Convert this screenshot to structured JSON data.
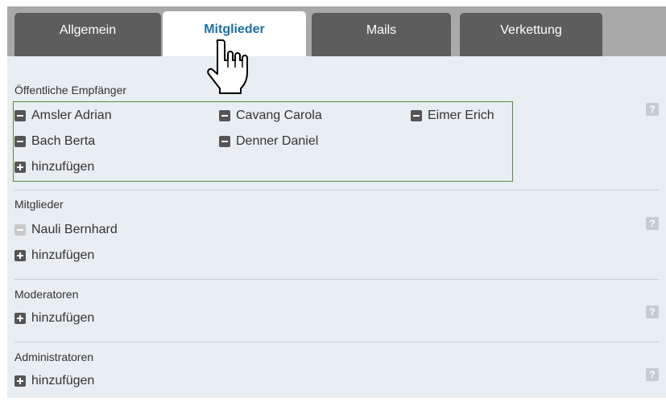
{
  "tabs": [
    {
      "label": "Allgemein"
    },
    {
      "label": "Mitglieder"
    },
    {
      "label": "Mails"
    },
    {
      "label": "Verkettung"
    }
  ],
  "sections": {
    "public": {
      "title": "Öffentliche Empfänger",
      "members": [
        "Amsler Adrian",
        "Cavang Carola",
        "Eimer Erich",
        "Bach Berta",
        "Denner Daniel"
      ],
      "add_label": "hinzufügen",
      "help": "?"
    },
    "members": {
      "title": "Mitglieder",
      "members": [
        "Nauli Bernhard"
      ],
      "add_label": "hinzufügen",
      "help": "?"
    },
    "moderators": {
      "title": "Moderatoren",
      "add_label": "hinzufügen",
      "help": "?"
    },
    "admins": {
      "title": "Administratoren",
      "add_label": "hinzufügen",
      "help": "?"
    }
  },
  "colors": {
    "active_tab_text": "#1e6fa8",
    "inactive_tab_bg": "#5d5d5d",
    "highlight_border": "#5c8c3a",
    "panel_bg": "#e8eef1"
  },
  "icons": [
    "minus-icon",
    "plus-icon",
    "help-icon",
    "hand-pointer-cursor-icon"
  ]
}
